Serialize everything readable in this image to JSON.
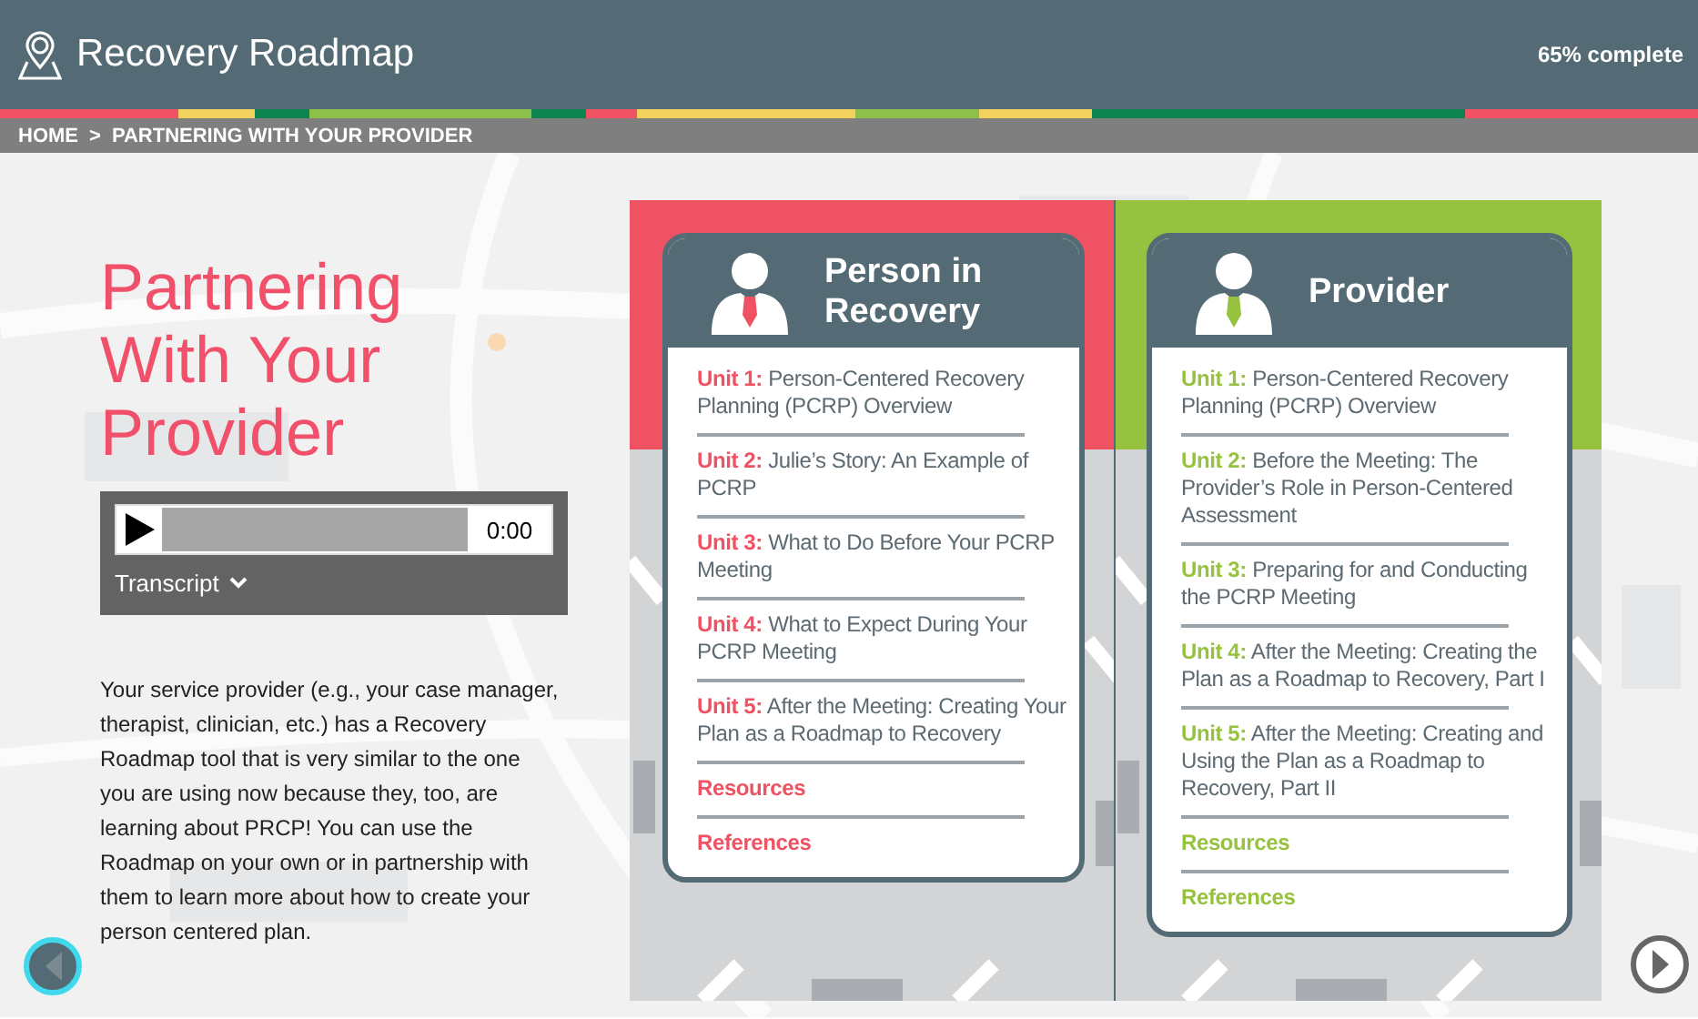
{
  "header": {
    "title": "Recovery Roadmap",
    "progress": "65% complete"
  },
  "breadcrumb": {
    "items": [
      "HOME",
      "PARTNERING WITH YOUR PROVIDER"
    ],
    "separator": ">"
  },
  "intro": {
    "heading": "Partnering With Your Provider",
    "player": {
      "time": "0:00",
      "level": 0,
      "transcript": "Transcript"
    },
    "paragraph": "Your service provider (e.g., your case manager, therapist, clinician, etc.) has a Recovery Roadmap tool that is very similar to the one you are using now because they, too, are learning about PRCP! You can use the Roadmap on your own or in partnership with them to learn more about how to create your person centered plan."
  },
  "columns": [
    {
      "title": "Person in Recovery",
      "color": "#ee5263",
      "items": [
        {
          "kind": "unit",
          "label": "Unit 1:",
          "text": "Person-Centered Recovery Planning  (PCRP) Overview"
        },
        {
          "kind": "unit",
          "label": "Unit 2:",
          "text": "Julie’s Story: An Example of PCRP"
        },
        {
          "kind": "unit",
          "label": "Unit 3:",
          "text": "What to Do Before Your PCRP Meeting"
        },
        {
          "kind": "unit",
          "label": "Unit 4:",
          "text": "What to Expect During Your PCRP Meeting"
        },
        {
          "kind": "unit",
          "label": "Unit 5:",
          "text": "After the Meeting: Creating Your Plan as a Roadmap to Recovery"
        },
        {
          "kind": "link",
          "text": "Resources"
        },
        {
          "kind": "link",
          "text": "References"
        }
      ]
    },
    {
      "title": "Provider",
      "color": "#97c23f",
      "items": [
        {
          "kind": "unit",
          "label": "Unit 1:",
          "text": "Person-Centered Recovery Planning (PCRP) Overview"
        },
        {
          "kind": "unit",
          "label": "Unit 2:",
          "text": "Before the Meeting: The Provider’s Role in Person-Centered Assessment"
        },
        {
          "kind": "unit",
          "label": "Unit 3:",
          "text": "Preparing for and Conducting the PCRP Meeting"
        },
        {
          "kind": "unit",
          "label": "Unit 4:",
          "text": "After the Meeting: Creating the Plan as a Roadmap to Recovery, Part I"
        },
        {
          "kind": "unit",
          "label": "Unit 5:",
          "text": "After the Meeting: Creating and Using the Plan as a Roadmap to Recovery, Part II"
        },
        {
          "kind": "link",
          "text": "Resources"
        },
        {
          "kind": "link",
          "text": "References"
        }
      ]
    }
  ]
}
